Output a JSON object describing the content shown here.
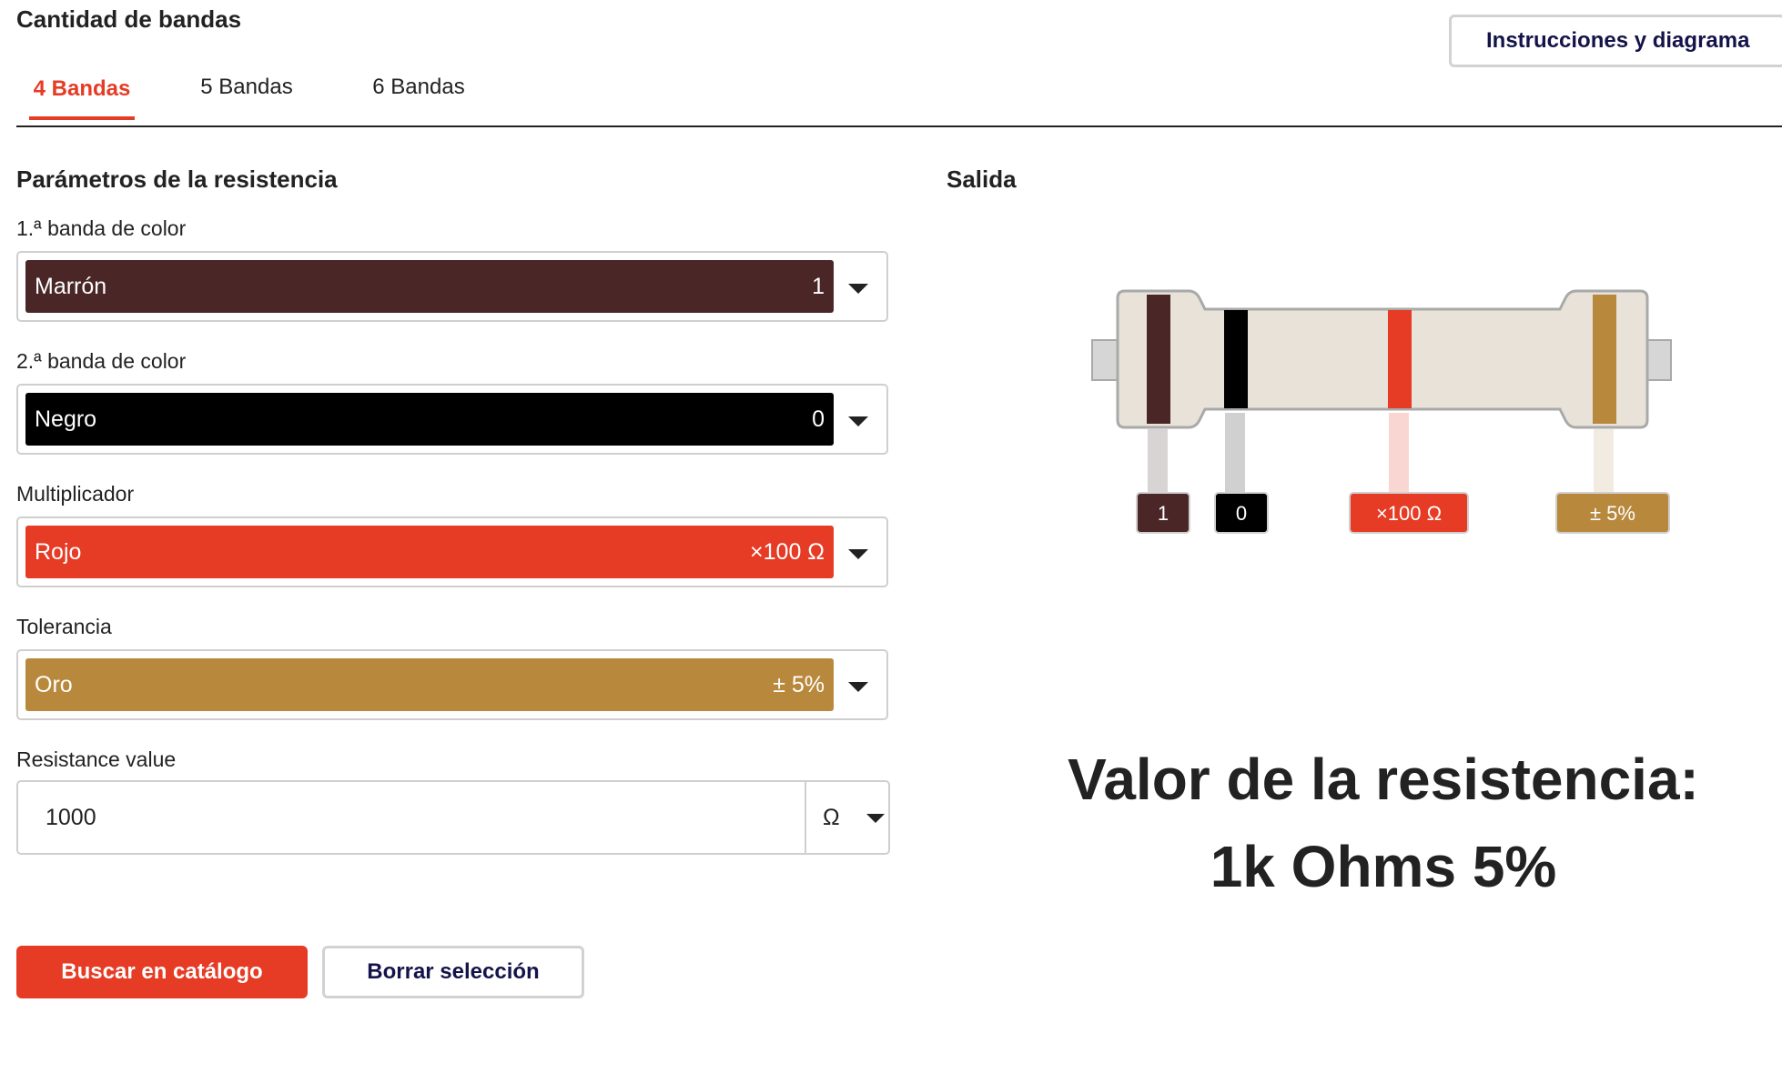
{
  "header": {
    "band_count_title": "Cantidad de bandas",
    "tabs": [
      {
        "label": "4 Bandas",
        "active": true
      },
      {
        "label": "5 Bandas",
        "active": false
      },
      {
        "label": "6 Bandas",
        "active": false
      }
    ],
    "instructions_button": "Instrucciones y diagrama"
  },
  "params": {
    "title": "Parámetros de la resistencia",
    "band1": {
      "label": "1.ª banda de color",
      "color_name": "Marrón",
      "value": "1",
      "color": "#4a2627"
    },
    "band2": {
      "label": "2.ª banda de color",
      "color_name": "Negro",
      "value": "0",
      "color": "#000000"
    },
    "multiplier": {
      "label": "Multiplicador",
      "color_name": "Rojo",
      "value": "×100 Ω",
      "color": "#e63b25"
    },
    "tolerance": {
      "label": "Tolerancia",
      "color_name": "Oro",
      "value": "± 5%",
      "color": "#b8893c"
    },
    "resistance": {
      "label": "Resistance value",
      "value": "1000",
      "unit": "Ω"
    }
  },
  "actions": {
    "search_button": "Buscar en catálogo",
    "clear_button": "Borrar selección"
  },
  "output": {
    "title": "Salida",
    "tags": [
      "1",
      "0",
      "×100 Ω",
      "± 5%"
    ],
    "result_line1": "Valor de la resistencia:",
    "result_line2": "1k Ohms 5%"
  },
  "colors": {
    "accent": "#e63b25",
    "resistor_body": "#e8e2d9",
    "resistor_outline": "#a9a9a9",
    "lead": "#d6d6d6",
    "navy_text": "#14144a"
  }
}
